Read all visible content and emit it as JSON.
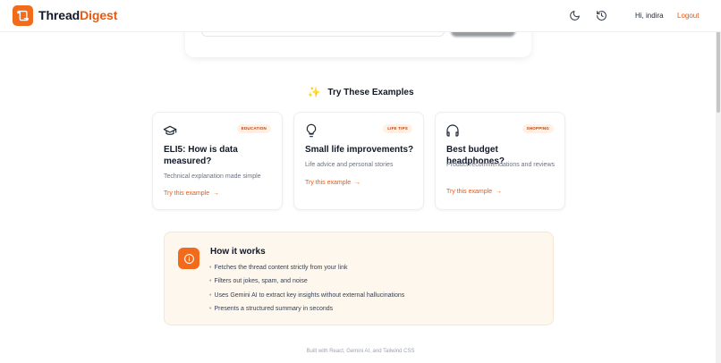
{
  "header": {
    "brand_part1": "Thread",
    "brand_part2": "Digest",
    "greeting": "Hi, indira",
    "logout_label": "Logout",
    "icons": [
      "moon-icon",
      "history-icon"
    ]
  },
  "examples": {
    "heading": "Try These Examples",
    "heading_icon": "sparkles-icon",
    "cards": [
      {
        "icon": "graduation-cap-icon",
        "tag": "EDUCATION",
        "title": "ELI5: How is data measured?",
        "description": "Technical explanation made simple",
        "link": "Try this example"
      },
      {
        "icon": "lightbulb-icon",
        "tag": "LIFE TIPS",
        "title": "Small life improvements?",
        "description": "Life advice and personal stories",
        "link": "Try this example"
      },
      {
        "icon": "headphones-icon",
        "tag": "SHOPPING",
        "title": "Best budget headphones?",
        "description": "Product recommendations and reviews",
        "link": "Try this example"
      }
    ]
  },
  "how_it_works": {
    "icon": "info-icon",
    "title": "How it works",
    "items": [
      "Fetches the thread content strictly from your link",
      "Filters out jokes, spam, and noise",
      "Uses Gemini AI to extract key insights without external hallucinations",
      "Presents a structured summary in seconds"
    ]
  },
  "footer": {
    "text": "Built with React, Gemini AI, and Tailwind CSS"
  },
  "colors": {
    "accent": "#ea580c",
    "accent_bg": "#f26a1b",
    "tag_bg": "#fff1e6",
    "how_bg": "#fdf7ee"
  }
}
